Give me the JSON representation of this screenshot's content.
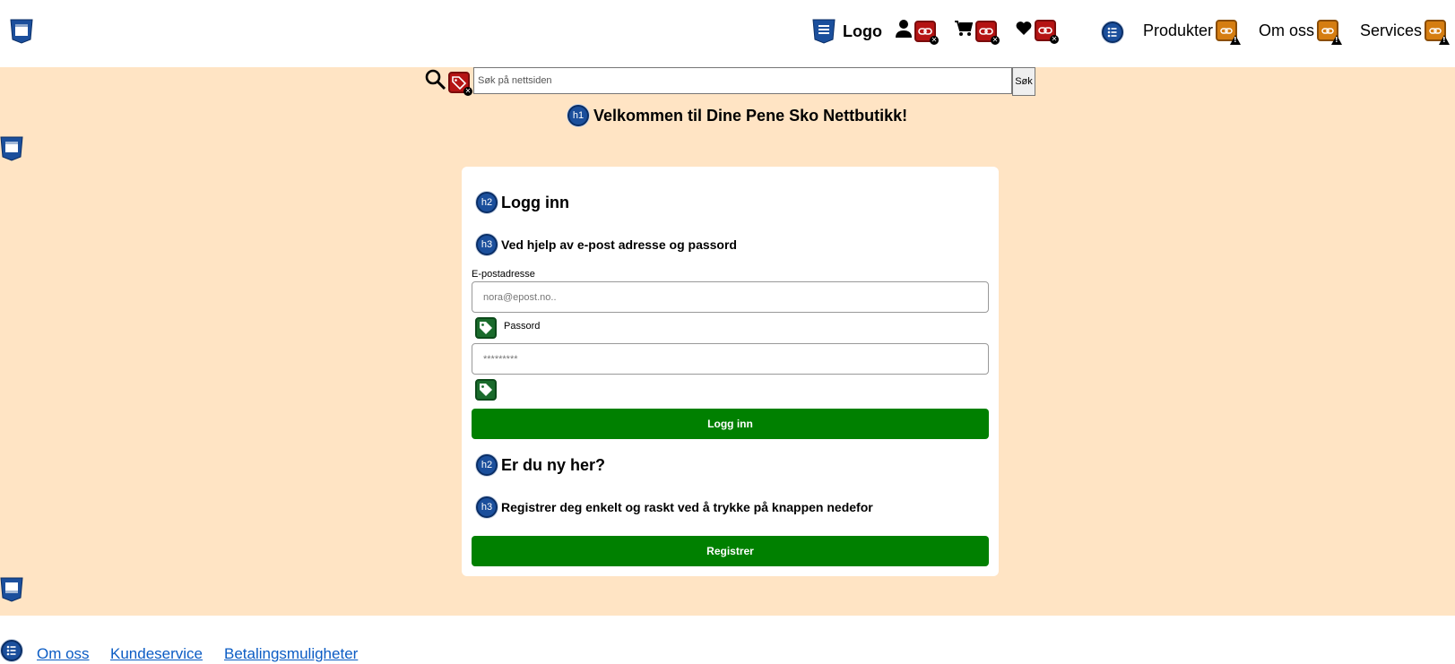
{
  "header": {
    "logo_text": "Logo",
    "menu": [
      {
        "label": "Produkter"
      },
      {
        "label": "Om oss"
      },
      {
        "label": "Services"
      }
    ]
  },
  "search": {
    "placeholder": "Søk på nettsiden",
    "button_label": "Søk"
  },
  "main": {
    "heading_tag": "h1",
    "welcome_title": "Velkommen til Dine Pene Sko Nettbutikk!"
  },
  "login": {
    "heading_tag": "h2",
    "title": "Logg inn",
    "sub_tag": "h3",
    "subtitle": "Ved hjelp av e-post adresse og passord",
    "email_label": "E-postadresse",
    "email_placeholder": "nora@epost.no..",
    "password_label": "Passord",
    "password_placeholder": "*********",
    "submit_label": "Logg inn"
  },
  "register": {
    "heading_tag": "h2",
    "title": "Er du ny her?",
    "sub_tag": "h3",
    "subtitle": "Registrer deg enkelt og raskt ved å trykke på knappen nedefor",
    "button_label": "Registrer"
  },
  "footer": {
    "links": [
      {
        "label": "Om oss"
      },
      {
        "label": "Kundeservice"
      },
      {
        "label": "Betalingsmuligheter"
      }
    ]
  },
  "colors": {
    "page_bg": "#ffe4c4",
    "button_green": "#008000",
    "link_blue": "#0b5cc4",
    "badge_red": "#b51414",
    "badge_orange": "#d57d11",
    "badge_green": "#1a6b2c",
    "heading_badge_blue": "#1b4f9c"
  }
}
